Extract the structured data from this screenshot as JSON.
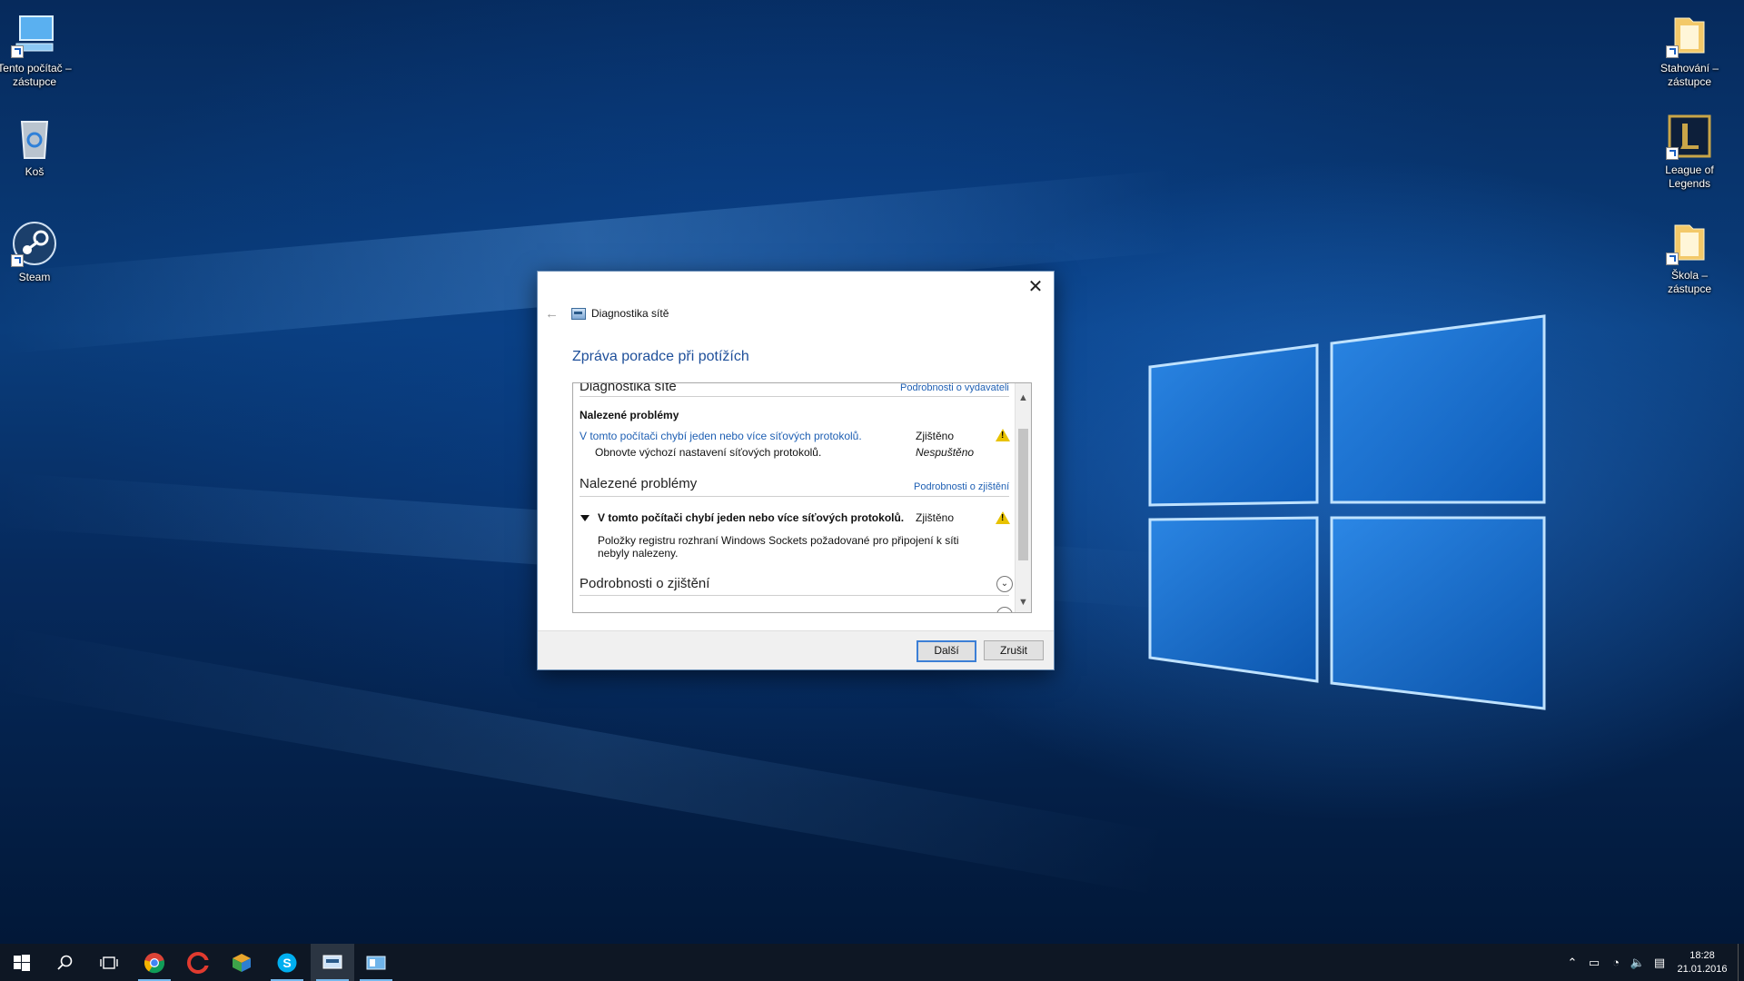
{
  "desktop": {
    "icons_left": [
      {
        "label": "Tento počítač – zástupce",
        "icon": "computer-icon"
      },
      {
        "label": "Koš",
        "icon": "recycle-bin-icon"
      },
      {
        "label": "Steam",
        "icon": "steam-icon"
      }
    ],
    "icons_right": [
      {
        "label": "Stahování – zástupce",
        "icon": "folder-icon"
      },
      {
        "label": "League of Legends",
        "icon": "league-of-legends-icon"
      },
      {
        "label": "Škola – zástupce",
        "icon": "folder-icon"
      }
    ]
  },
  "dialog": {
    "app_title": "Diagnostika sítě",
    "heading": "Zpráva poradce při potížích",
    "close_glyph": "✕",
    "back_glyph": "←",
    "report": {
      "section1_title": "Diagnostika sítě",
      "section1_link": "Podrobnosti o vydavateli",
      "found_problems_label": "Nalezené problémy",
      "problem1_text": "V tomto počítači chybí jeden nebo více síťových protokolů.",
      "problem1_status": "Zjištěno",
      "fix1_text": "Obnovte výchozí nastavení síťových protokolů.",
      "fix1_status": "Nespuštěno",
      "section2_title": "Nalezené problémy",
      "section2_link": "Podrobnosti o zjištění",
      "problem2_text": "V tomto počítači chybí jeden nebo více síťových protokolů.",
      "problem2_status": "Zjištěno",
      "problem2_detail": "Položky registru rozhraní Windows Sockets požadované pro připojení k síti nebyly nalezeny.",
      "section3_title": "Podrobnosti o zjištění"
    },
    "buttons": {
      "next": "Další",
      "cancel": "Zrušit"
    }
  },
  "taskbar": {
    "pinned": [
      "start-icon",
      "search-icon",
      "task-view-icon",
      "chrome-icon",
      "ccleaner-icon",
      "app-cube-icon",
      "skype-icon",
      "network-diagnostics-icon",
      "control-panel-icon"
    ],
    "active_index": 7,
    "clock": {
      "time": "18:28",
      "date": "21.01.2016"
    }
  },
  "colors": {
    "link": "#1e5fb3",
    "accent": "#3c7fd6",
    "warning": "#e8c200",
    "taskbar": "#0e1724"
  }
}
